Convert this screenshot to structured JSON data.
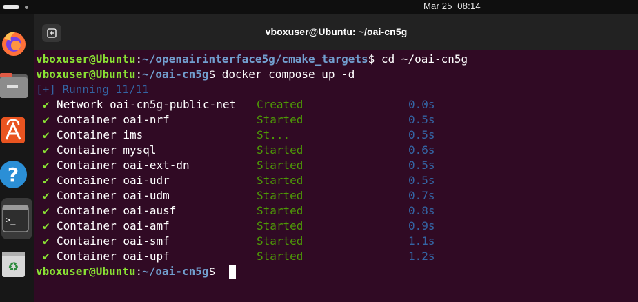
{
  "topbar": {
    "clock": "Mar 25  08:14"
  },
  "dock": {
    "items": [
      {
        "name": "firefox-icon"
      },
      {
        "name": "files-icon"
      },
      {
        "name": "app-center-icon"
      },
      {
        "name": "help-icon"
      },
      {
        "name": "terminal-icon",
        "active": true
      },
      {
        "name": "trash-icon"
      }
    ]
  },
  "window": {
    "title": "vboxuser@Ubuntu: ~/oai-cn5g",
    "new_tab_icon": "new-tab-icon"
  },
  "terminal": {
    "line1": {
      "user": "vboxuser@Ubuntu",
      "sep": ":",
      "path": "~/openairinterface5g/cmake_targets",
      "sym": "$",
      "cmd": " cd ~/oai-cn5g"
    },
    "line2": {
      "user": "vboxuser@Ubuntu",
      "sep": ":",
      "path": "~/oai-cn5g",
      "sym": "$",
      "cmd": " docker compose up -d"
    },
    "running": "[+] Running 11/11",
    "rows": [
      {
        "check": "✔",
        "name": "Network oai-cn5g-public-net",
        "status": "Created",
        "time": "0.0s"
      },
      {
        "check": "✔",
        "name": "Container oai-nrf",
        "status": "Started",
        "time": "0.5s"
      },
      {
        "check": "✔",
        "name": "Container ims",
        "status": "St...",
        "time": "0.5s"
      },
      {
        "check": "✔",
        "name": "Container mysql",
        "status": "Started",
        "time": "0.6s"
      },
      {
        "check": "✔",
        "name": "Container oai-ext-dn",
        "status": "Started",
        "time": "0.5s"
      },
      {
        "check": "✔",
        "name": "Container oai-udr",
        "status": "Started",
        "time": "0.5s"
      },
      {
        "check": "✔",
        "name": "Container oai-udm",
        "status": "Started",
        "time": "0.7s"
      },
      {
        "check": "✔",
        "name": "Container oai-ausf",
        "status": "Started",
        "time": "0.8s"
      },
      {
        "check": "✔",
        "name": "Container oai-amf",
        "status": "Started",
        "time": "0.9s"
      },
      {
        "check": "✔",
        "name": "Container oai-smf",
        "status": "Started",
        "time": "1.1s"
      },
      {
        "check": "✔",
        "name": "Container oai-upf",
        "status": "Started",
        "time": "1.2s"
      }
    ],
    "line_last": {
      "user": "vboxuser@Ubuntu",
      "sep": ":",
      "path": "~/oai-cn5g",
      "sym": "$ "
    }
  }
}
